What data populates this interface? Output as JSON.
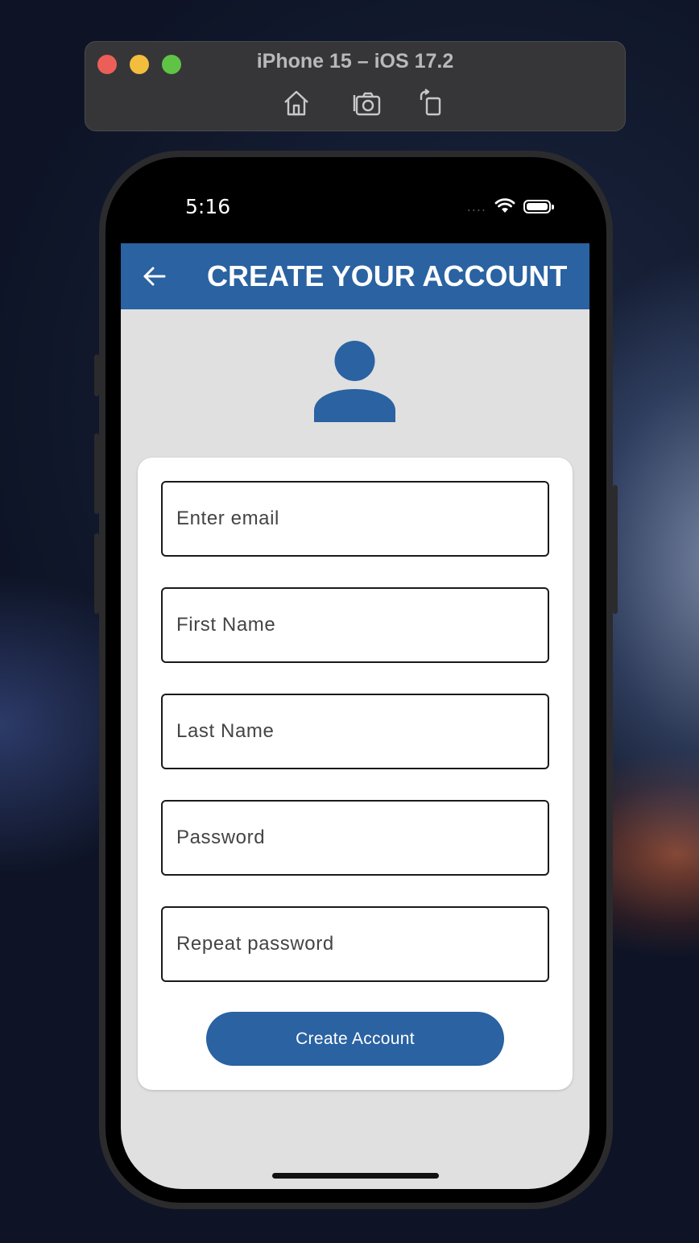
{
  "simulator": {
    "title": "iPhone 15 – iOS 17.2",
    "icons": [
      "home-icon",
      "screenshot-camera-icon",
      "rotate-icon"
    ]
  },
  "status_bar": {
    "time": "5:16",
    "signal": "....",
    "icons": [
      "wifi-icon",
      "battery-icon"
    ]
  },
  "app_bar": {
    "title": "CREATE YOUR ACCOUNT",
    "color": "#2a62a2",
    "back_icon": "back-arrow-icon"
  },
  "avatar_icon": "person-icon",
  "form": {
    "fields": [
      {
        "placeholder": "Enter email",
        "value": ""
      },
      {
        "placeholder": "First Name",
        "value": ""
      },
      {
        "placeholder": "Last Name",
        "value": ""
      },
      {
        "placeholder": "Password",
        "value": ""
      },
      {
        "placeholder": "Repeat password",
        "value": ""
      }
    ],
    "submit_label": "Create Account"
  },
  "colors": {
    "primary": "#2a62a2",
    "background": "#e0e0e0",
    "card": "#ffffff"
  }
}
